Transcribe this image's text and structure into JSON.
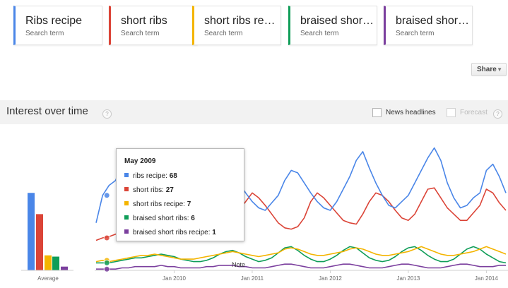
{
  "search_terms": [
    {
      "name": "Ribs recipe",
      "label": "Search term",
      "color": "#4a86e8"
    },
    {
      "name": "short ribs",
      "label": "Search term",
      "color": "#db4437"
    },
    {
      "name": "short ribs recipe",
      "label": "Search term",
      "color": "#f4b400"
    },
    {
      "name": "braised short ribs",
      "label": "Search term",
      "color": "#0f9d58"
    },
    {
      "name": "braised short ribs recipe",
      "label": "Search term",
      "color": "#7b3f9e"
    }
  ],
  "share": {
    "label": "Share"
  },
  "section": {
    "title": "Interest over time",
    "help_icon": "?",
    "news_headlines": {
      "label": "News headlines",
      "checked": false
    },
    "forecast": {
      "label": "Forecast",
      "checked": false,
      "enabled": false
    }
  },
  "tooltip": {
    "date": "May 2009",
    "entries": [
      {
        "term": "ribs recipe",
        "value": "68",
        "color": "#4a86e8"
      },
      {
        "term": "short ribs",
        "value": "27",
        "color": "#db4437"
      },
      {
        "term": "short ribs recipe",
        "value": "7",
        "color": "#f4b400"
      },
      {
        "term": "braised short ribs",
        "value": "6",
        "color": "#0f9d58"
      },
      {
        "term": "braised short ribs recipe",
        "value": "1",
        "color": "#7b3f9e"
      }
    ]
  },
  "chart_data": {
    "type": "line",
    "ylim": [
      0,
      100
    ],
    "x_ticks": [
      "Jan 2010",
      "Jan 2011",
      "Jan 2012",
      "Jan 2013",
      "Jan 2014"
    ],
    "annotation": "Note",
    "hover_date": "May 2009",
    "average": {
      "label": "Average",
      "values": [
        {
          "term": "ribs recipe",
          "value": 62
        },
        {
          "term": "short ribs",
          "value": 45
        },
        {
          "term": "short ribs recipe",
          "value": 12
        },
        {
          "term": "braised short ribs",
          "value": 11
        },
        {
          "term": "braised short ribs recipe",
          "value": 3
        }
      ]
    },
    "x_range": [
      "Jan 2009",
      "Mar 2014"
    ],
    "series": [
      {
        "name": "ribs recipe",
        "color": "#4a86e8",
        "values": [
          38,
          60,
          68,
          72,
          85,
          80,
          70,
          60,
          50,
          48,
          50,
          55,
          62,
          60,
          55,
          48,
          44,
          50,
          55,
          60,
          72,
          78,
          70,
          62,
          55,
          50,
          48,
          54,
          60,
          72,
          80,
          78,
          70,
          62,
          55,
          50,
          48,
          55,
          65,
          75,
          88,
          95,
          82,
          70,
          60,
          52,
          50,
          55,
          60,
          70,
          80,
          90,
          98,
          88,
          70,
          58,
          50,
          52,
          58,
          62,
          80,
          85,
          75,
          62
        ]
      },
      {
        "name": "short ribs",
        "color": "#db4437",
        "values": [
          24,
          26,
          27,
          29,
          30,
          33,
          35,
          38,
          40,
          42,
          45,
          42,
          38,
          35,
          32,
          30,
          30,
          30,
          30,
          30,
          35,
          40,
          48,
          55,
          62,
          58,
          52,
          45,
          38,
          34,
          33,
          35,
          42,
          55,
          62,
          58,
          52,
          46,
          40,
          38,
          37,
          45,
          55,
          62,
          60,
          55,
          48,
          42,
          40,
          45,
          55,
          65,
          66,
          58,
          50,
          45,
          40,
          40,
          46,
          52,
          65,
          62,
          54,
          48
        ]
      },
      {
        "name": "short ribs recipe",
        "color": "#f4b400",
        "values": [
          7,
          8,
          7,
          8,
          9,
          10,
          11,
          12,
          12,
          13,
          12,
          11,
          10,
          9,
          9,
          9,
          10,
          11,
          12,
          13,
          14,
          15,
          14,
          13,
          12,
          11,
          12,
          13,
          14,
          17,
          18,
          17,
          15,
          13,
          12,
          12,
          13,
          14,
          15,
          17,
          18,
          17,
          15,
          13,
          12,
          12,
          13,
          14,
          15,
          17,
          19,
          17,
          15,
          13,
          12,
          12,
          13,
          14,
          15,
          17,
          19,
          17,
          15,
          13
        ]
      },
      {
        "name": "braised short ribs",
        "color": "#0f9d58",
        "values": [
          6,
          6,
          6,
          7,
          8,
          9,
          10,
          10,
          11,
          12,
          13,
          12,
          11,
          9,
          8,
          7,
          7,
          8,
          10,
          13,
          15,
          16,
          14,
          11,
          9,
          7,
          8,
          10,
          14,
          18,
          19,
          16,
          12,
          9,
          7,
          7,
          9,
          12,
          16,
          19,
          18,
          14,
          10,
          8,
          7,
          8,
          11,
          15,
          18,
          19,
          16,
          12,
          9,
          7,
          7,
          9,
          13,
          17,
          19,
          17,
          13,
          10,
          7,
          6
        ]
      },
      {
        "name": "braised short ribs recipe",
        "color": "#7b3f9e",
        "values": [
          1,
          1,
          1,
          1,
          2,
          2,
          3,
          3,
          3,
          3,
          4,
          3,
          3,
          2,
          2,
          2,
          2,
          3,
          3,
          4,
          4,
          4,
          3,
          3,
          2,
          2,
          2,
          3,
          4,
          5,
          5,
          4,
          3,
          2,
          2,
          2,
          3,
          4,
          5,
          5,
          4,
          3,
          2,
          2,
          2,
          3,
          4,
          5,
          5,
          4,
          3,
          2,
          2,
          2,
          3,
          4,
          5,
          5,
          4,
          3,
          3,
          3,
          4,
          4
        ]
      }
    ]
  }
}
